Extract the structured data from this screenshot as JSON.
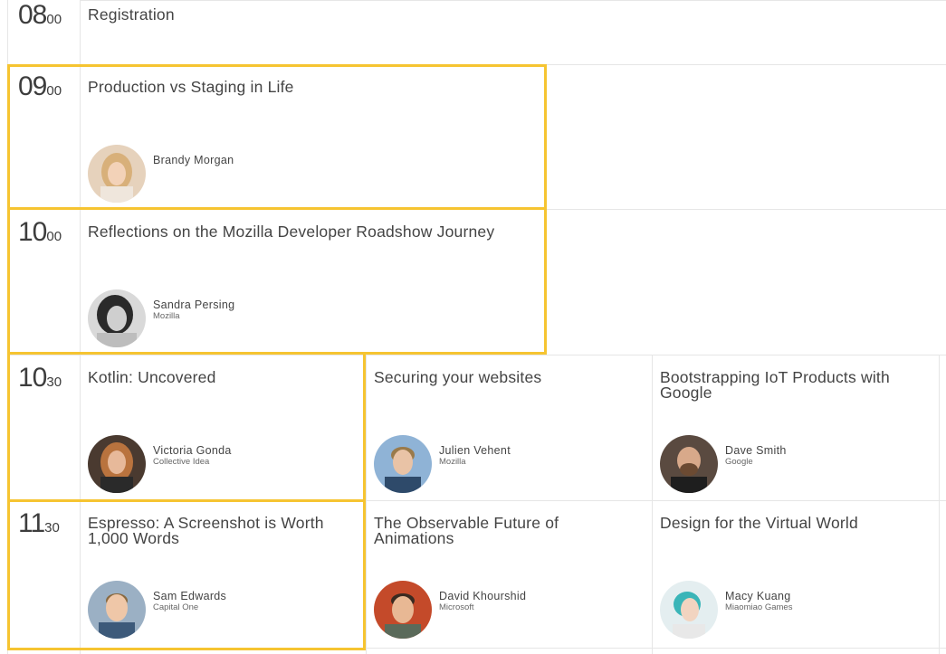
{
  "accent_color": "#f6c431",
  "times": [
    {
      "hour": "08",
      "minute": "00"
    },
    {
      "hour": "09",
      "minute": "00"
    },
    {
      "hour": "10",
      "minute": "00"
    },
    {
      "hour": "10",
      "minute": "30"
    },
    {
      "hour": "11",
      "minute": "30"
    }
  ],
  "sessions": [
    {
      "title": "Registration"
    },
    {
      "title": "Production vs Staging in Life",
      "speaker": "Brandy Morgan",
      "org": ""
    },
    {
      "title": "Reflections on the Mozilla Developer Roadshow Journey",
      "speaker": "Sandra Persing",
      "org": "Mozilla"
    },
    {
      "title": "Kotlin: Uncovered",
      "speaker": "Victoria Gonda",
      "org": "Collective Idea"
    },
    {
      "title": "Securing your websites",
      "speaker": "Julien Vehent",
      "org": "Mozilla"
    },
    {
      "title": "Bootstrapping IoT Products with Google",
      "speaker": "Dave Smith",
      "org": "Google"
    },
    {
      "title": "Espresso: A Screenshot is Worth 1,000 Words",
      "speaker": "Sam Edwards",
      "org": "Capital One"
    },
    {
      "title": "The Observable Future of Animations",
      "speaker": "David Khourshid",
      "org": "Microsoft"
    },
    {
      "title": "Design for the Virtual World",
      "speaker": "Macy Kuang",
      "org": "Miaomiao Games"
    }
  ]
}
